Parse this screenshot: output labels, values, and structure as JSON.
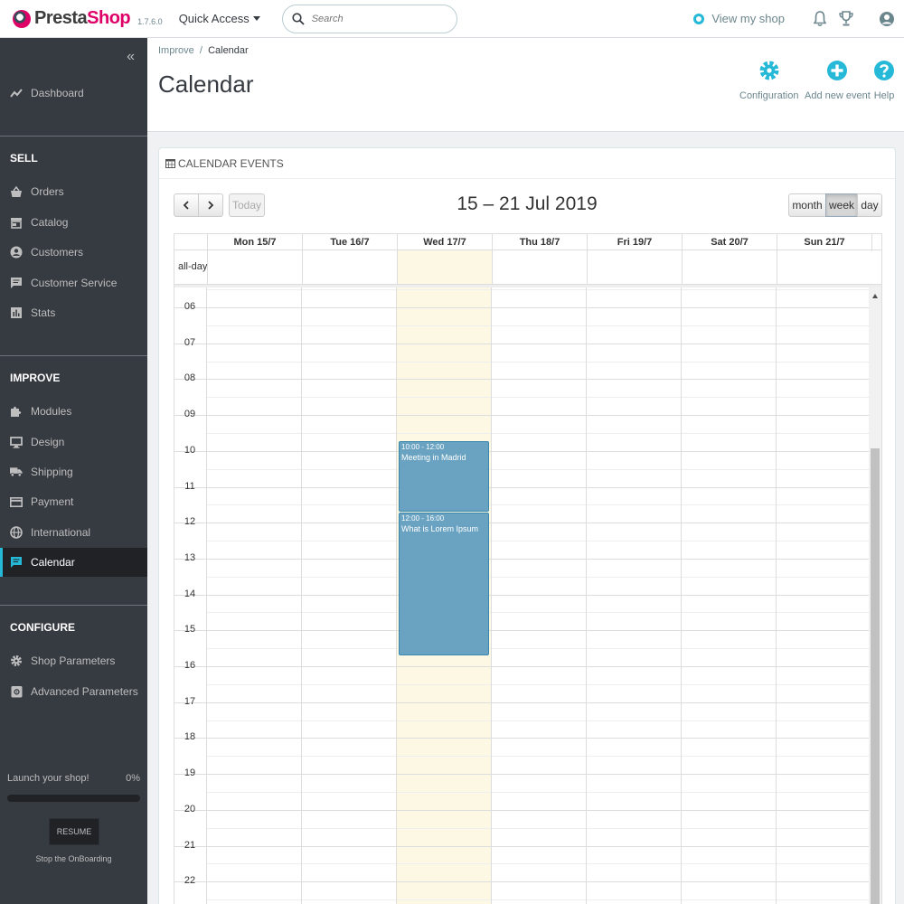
{
  "topbar": {
    "brand_a": "Presta",
    "brand_b": "Shop",
    "version": "1.7.6.0",
    "quick_access": "Quick Access",
    "search_placeholder": "Search",
    "view_shop": "View my shop"
  },
  "sidebar": {
    "dashboard": "Dashboard",
    "sections": {
      "sell": "SELL",
      "improve": "IMPROVE",
      "configure": "CONFIGURE"
    },
    "sell_items": [
      "Orders",
      "Catalog",
      "Customers",
      "Customer Service",
      "Stats"
    ],
    "improve_items": [
      "Modules",
      "Design",
      "Shipping",
      "Payment",
      "International",
      "Calendar"
    ],
    "configure_items": [
      "Shop Parameters",
      "Advanced Parameters"
    ],
    "active_item": "Calendar",
    "onboarding": {
      "label": "Launch your shop!",
      "percent_text": "0%",
      "percent": 0,
      "resume": "RESUME",
      "stop": "Stop the OnBoarding"
    }
  },
  "header": {
    "breadcrumb_parent": "Improve",
    "breadcrumb_sep": "/",
    "breadcrumb_current": "Calendar",
    "title": "Calendar",
    "toolbar": {
      "configuration": "Configuration",
      "add_event": "Add new event",
      "help": "Help"
    }
  },
  "panel": {
    "heading": "CALENDAR EVENTS",
    "today": "Today",
    "range_title": "15 – 21 Jul 2019",
    "views": {
      "month": "month",
      "week": "week",
      "day": "day"
    },
    "active_view": "week",
    "all_day": "all-day",
    "days": [
      "Mon 15/7",
      "Tue 16/7",
      "Wed 17/7",
      "Thu 18/7",
      "Fri 19/7",
      "Sat 20/7",
      "Sun 21/7"
    ],
    "today_index": 2,
    "hours": [
      "06",
      "07",
      "08",
      "09",
      "10",
      "11",
      "12",
      "13",
      "14",
      "15",
      "16",
      "17",
      "18",
      "19",
      "20",
      "21",
      "22"
    ],
    "events": [
      {
        "time": "10:00 - 12:00",
        "title": "Meeting in Madrid",
        "day": 2,
        "start": 10,
        "end": 12
      },
      {
        "time": "12:00 - 16:00",
        "title": "What is Lorem Ipsum",
        "day": 2,
        "start": 12,
        "end": 16
      }
    ]
  },
  "colors": {
    "accent": "#25b9d7",
    "sidebar_bg": "#363a41",
    "event_bg": "#6aa3c1",
    "today_bg": "#fcf8e3"
  }
}
